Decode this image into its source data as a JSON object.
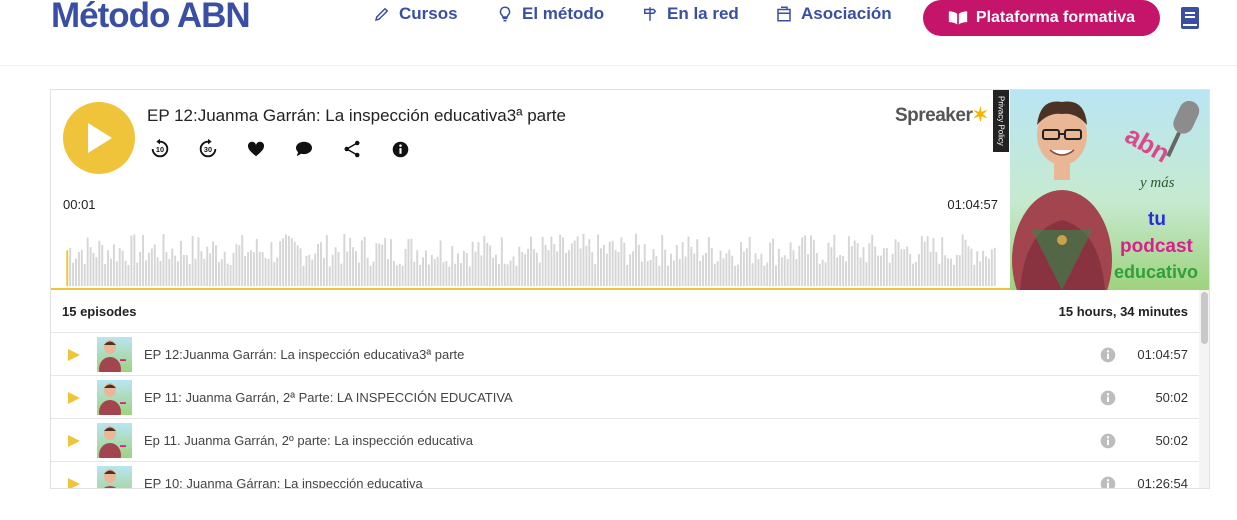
{
  "site": {
    "brand": "Método ABN"
  },
  "nav": {
    "items": [
      {
        "label": "Cursos",
        "icon": "pencil-icon"
      },
      {
        "label": "El método",
        "icon": "lightbulb-icon"
      },
      {
        "label": "En la red",
        "icon": "signpost-icon"
      },
      {
        "label": "Asociación",
        "icon": "building-icon"
      }
    ],
    "cta_label": "Plataforma formativa",
    "cta_icon": "book-open-icon",
    "extra_icon": "book-icon"
  },
  "colors": {
    "brand": "#3a4fa4",
    "cta": "#c5156b",
    "player_accent": "#f0c43a"
  },
  "player": {
    "title": "EP 12:Juanma Garrán: La inspección educativa3ª parte",
    "logo": "Spreaker",
    "privacy": "Privacy Policy",
    "current_time": "00:01",
    "duration": "01:04:57",
    "controls": [
      "rewind-10-icon",
      "forward-30-icon",
      "heart-icon",
      "comment-icon",
      "share-icon",
      "info-icon"
    ],
    "rewind_label": "10",
    "forward_label": "30",
    "cover": {
      "line1": "abn",
      "line2": "y más",
      "line3": "tu",
      "line4": "podcast",
      "line5": "educativo"
    }
  },
  "episodes": {
    "count_label": "15 episodes",
    "total_label": "15 hours, 34 minutes",
    "items": [
      {
        "title": "EP 12:Juanma Garrán: La inspección educativa3ª parte",
        "duration": "01:04:57"
      },
      {
        "title": "EP 11: Juanma Garrán, 2ª Parte: LA INSPECCIÓN EDUCATIVA",
        "duration": "50:02"
      },
      {
        "title": "Ep 11. Juanma Garrán, 2º parte: La inspección educativa",
        "duration": "50:02"
      },
      {
        "title": "EP 10: Juanma Gárran: La inspección educativa",
        "duration": "01:26:54"
      }
    ]
  }
}
